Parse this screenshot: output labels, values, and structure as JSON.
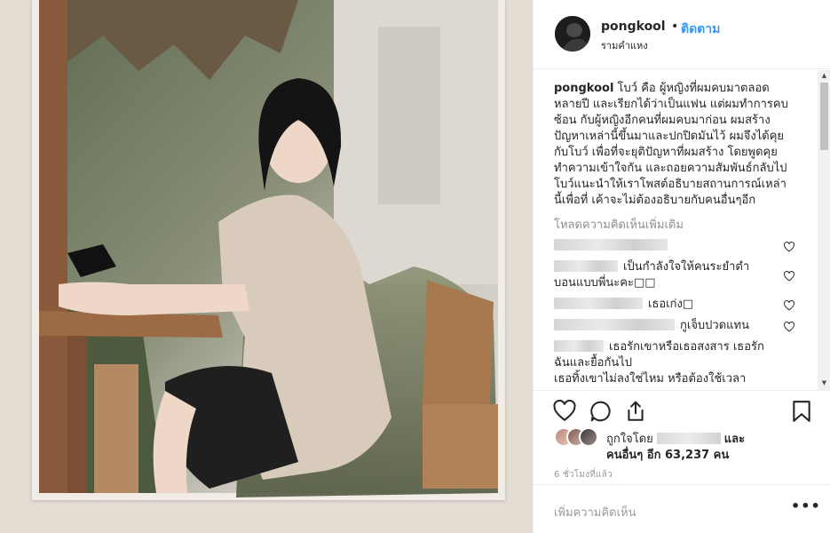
{
  "post": {
    "username": "pongkool",
    "separator": "•",
    "follow_label": "ติดตาม",
    "location": "รามคำแหง"
  },
  "caption": {
    "username": "pongkool",
    "lines": [
      " โบว์ คือ ผู้หญิงที่ผมคบมาตลอด",
      "หลายปี และเรียกได้ว่าเป็นแฟน แต่ผมทำการคบ",
      "ซ้อน กับผู้หญิงอีกคนที่ผมคบมาก่อน ผมสร้าง",
      "ปัญหาเหล่านี้ขึ้นมาและปกปิดมันไว้ ผมจึงได้คุย",
      "กับโบว์ เพื่อที่จะยุติปัญหาที่ผมสร้าง โดยพูดคุย",
      "ทำความเข้าใจกัน และถอยความสัมพันธ์กลับไป",
      "โบว์แนะนำให้เราโพสต์อธิบายสถานการณ์เหล่า",
      "นี้เพื่อที่ เค้าจะไม่ต้องอธิบายกับคนอื่นๆอีก"
    ]
  },
  "load_more": "โหลดความคิดเห็นเพิ่มเติม",
  "comments": [
    {
      "text": "",
      "lines": []
    },
    {
      "text": "เป็นกำลังใจให้คนระยำตำ",
      "line2": "บอนแบบพี่นะคะ□□"
    },
    {
      "text": "เธอเก่ง□"
    },
    {
      "text": "กูเจ็บปวดแทน"
    },
    {
      "text": "เธอรักเขาหรือเธอสงสาร เธอรัก",
      "line2": "ฉันและยื้อกันไป",
      "line3": "เธอทิ้งเขาไม่ลงใช่ไหม หรือต้องใช้เวลา"
    }
  ],
  "likes": {
    "prefix": "ถูกใจโดย",
    "suffix": "และ",
    "others": "คนอื่นๆ อีก 63,237 คน"
  },
  "timestamp": "6 ชั่วโมงที่แล้ว",
  "add_comment_placeholder": "เพิ่มความคิดเห็น",
  "more_options": "•••",
  "icons": {
    "like": "heart-icon",
    "comment": "comment-icon",
    "share": "share-icon",
    "save": "bookmark-icon",
    "comment_like": "heart-icon"
  },
  "colors": {
    "accent": "#3897f0",
    "text": "#262626",
    "muted": "#8e8e8e",
    "border": "#efefef"
  }
}
